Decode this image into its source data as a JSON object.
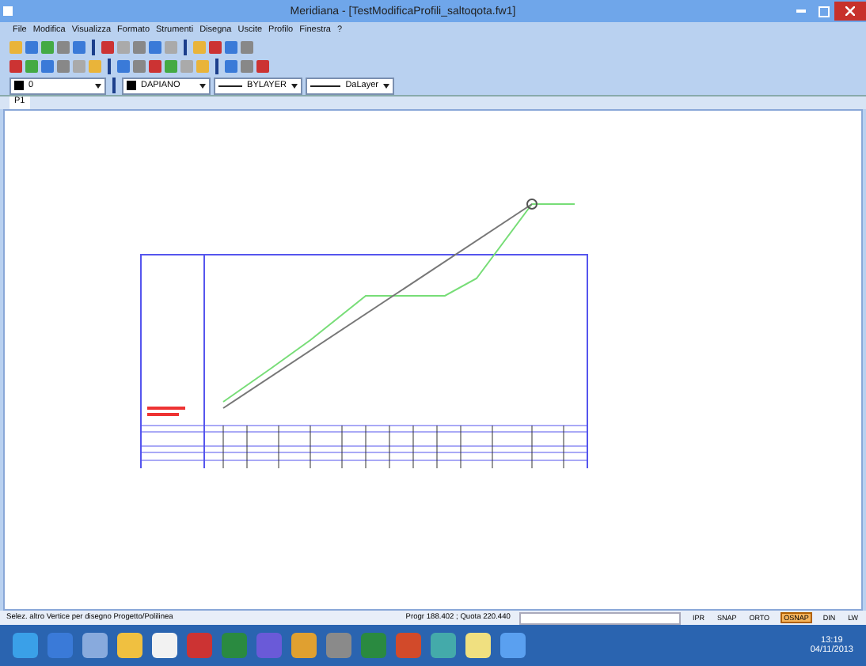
{
  "window": {
    "title": "Meridiana - [TestModificaProfili_saltoqota.fw1]"
  },
  "menu": [
    "File",
    "Modifica",
    "Visualizza",
    "Formato",
    "Strumenti",
    "Disegna",
    "Uscite",
    "Profilo",
    "Finestra",
    "?"
  ],
  "layer_bar": {
    "layer": "0",
    "colour_setting": "DAPIANO",
    "linetype": "BYLAYER",
    "lineweight": "DaLayer"
  },
  "tabs": [
    {
      "label": "P1",
      "selected": true
    }
  ],
  "status_bar": {
    "prompt": "Selez. altro Vertice per disegno Progetto/Polilinea",
    "coords": "Progr  188.402 ; Quota  220.440",
    "toggles": [
      {
        "label": "IPR",
        "on": false
      },
      {
        "label": "SNAP",
        "on": false
      },
      {
        "label": "ORTO",
        "on": false
      },
      {
        "label": "OSNAP",
        "on": true
      },
      {
        "label": "DIN",
        "on": false
      },
      {
        "label": "LW",
        "on": false
      }
    ]
  },
  "taskbar": {
    "time": "13:19",
    "date": "04/11/2013"
  }
}
